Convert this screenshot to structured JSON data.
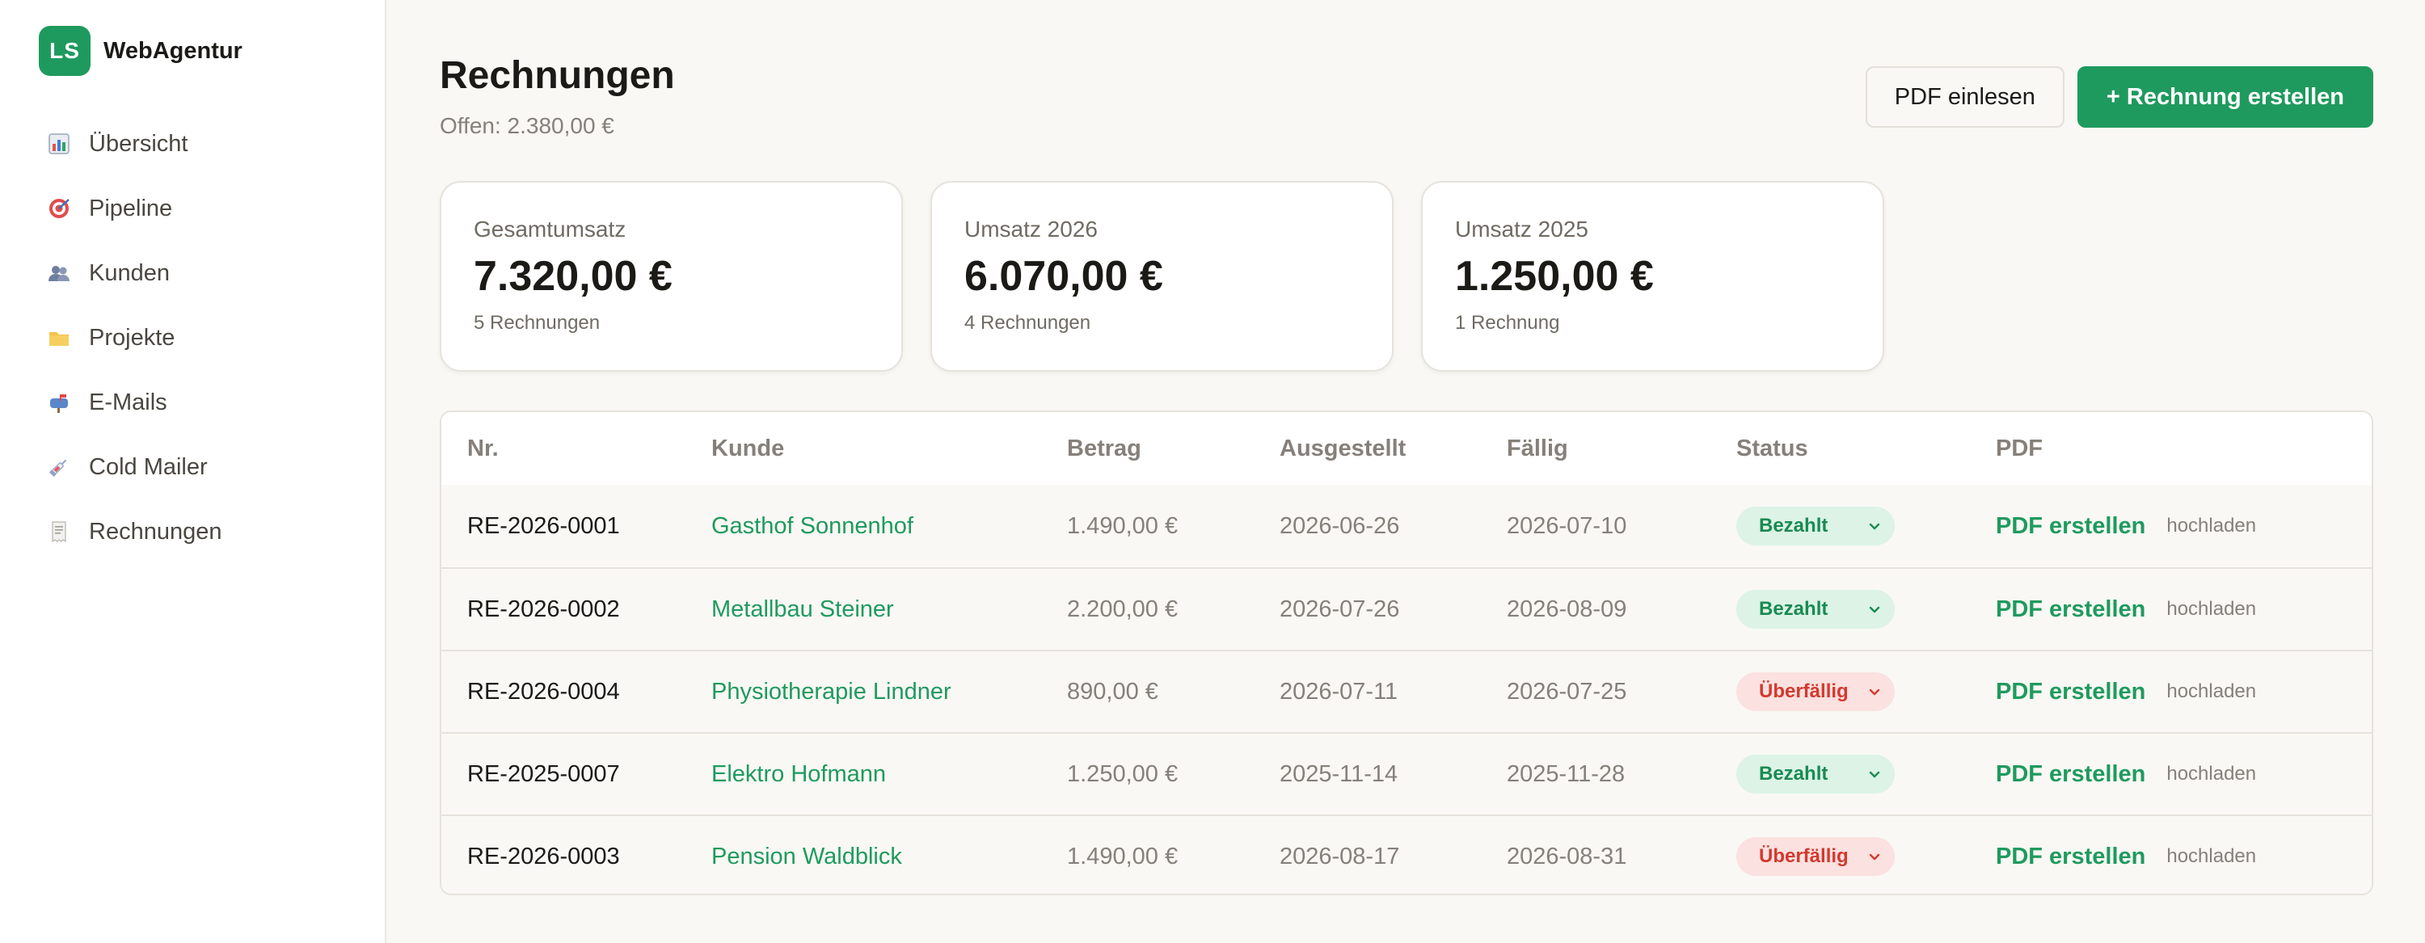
{
  "brand": {
    "logo_text": "LS",
    "name": "WebAgentur",
    "color": "#1f9a5e"
  },
  "nav": {
    "items": [
      {
        "label": "Übersicht",
        "icon": "chart-icon"
      },
      {
        "label": "Pipeline",
        "icon": "target-icon"
      },
      {
        "label": "Kunden",
        "icon": "users-icon"
      },
      {
        "label": "Projekte",
        "icon": "folder-icon"
      },
      {
        "label": "E-Mails",
        "icon": "mailbox-icon"
      },
      {
        "label": "Cold Mailer",
        "icon": "syringe-icon"
      },
      {
        "label": "Rechnungen",
        "icon": "receipt-icon"
      }
    ]
  },
  "header": {
    "title": "Rechnungen",
    "subtitle": "Offen: 2.380,00 €",
    "btn_import": "PDF einlesen",
    "btn_create": "+ Rechnung erstellen"
  },
  "cards": [
    {
      "label": "Gesamtumsatz",
      "value": "7.320,00 €",
      "sub": "5 Rechnungen"
    },
    {
      "label": "Umsatz 2026",
      "value": "6.070,00 €",
      "sub": "4 Rechnungen"
    },
    {
      "label": "Umsatz 2025",
      "value": "1.250,00 €",
      "sub": "1 Rechnung"
    }
  ],
  "table": {
    "headers": {
      "nr": "Nr.",
      "kunde": "Kunde",
      "betrag": "Betrag",
      "ausgestellt": "Ausgestellt",
      "faellig": "Fällig",
      "status": "Status",
      "pdf": "PDF"
    },
    "pdf_create_label": "PDF erstellen",
    "pdf_upload_label": "hochladen",
    "rows": [
      {
        "nr": "RE-2026-0001",
        "kunde": "Gasthof Sonnenhof",
        "betrag": "1.490,00 €",
        "ausgestellt": "2026-06-26",
        "faellig": "2026-07-10",
        "status": "Bezahlt",
        "status_type": "paid"
      },
      {
        "nr": "RE-2026-0002",
        "kunde": "Metallbau Steiner",
        "betrag": "2.200,00 €",
        "ausgestellt": "2026-07-26",
        "faellig": "2026-08-09",
        "status": "Bezahlt",
        "status_type": "paid"
      },
      {
        "nr": "RE-2026-0004",
        "kunde": "Physiotherapie Lindner",
        "betrag": "890,00 €",
        "ausgestellt": "2026-07-11",
        "faellig": "2026-07-25",
        "status": "Überfällig",
        "status_type": "overdue"
      },
      {
        "nr": "RE-2025-0007",
        "kunde": "Elektro Hofmann",
        "betrag": "1.250,00 €",
        "ausgestellt": "2025-11-14",
        "faellig": "2025-11-28",
        "status": "Bezahlt",
        "status_type": "paid"
      },
      {
        "nr": "RE-2026-0003",
        "kunde": "Pension Waldblick",
        "betrag": "1.490,00 €",
        "ausgestellt": "2026-08-17",
        "faellig": "2026-08-31",
        "status": "Überfällig",
        "status_type": "overdue"
      }
    ]
  },
  "colors": {
    "accent": "#1f9a5e",
    "paid_bg": "#dcf3e6",
    "overdue_bg": "#fbe1df",
    "overdue_text": "#d23a30"
  }
}
